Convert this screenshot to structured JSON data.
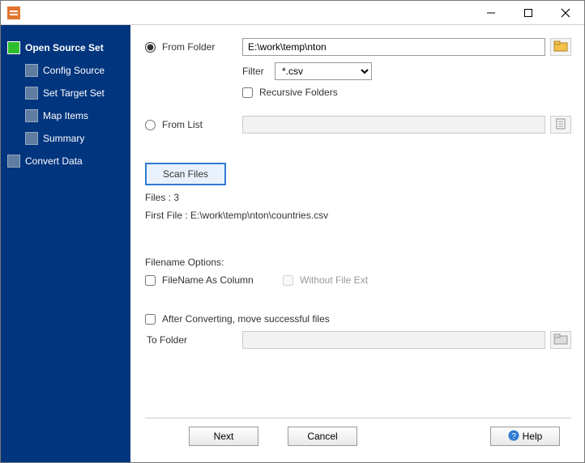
{
  "sidebar": {
    "items": [
      {
        "label": "Open Source Set"
      },
      {
        "label": "Config Source"
      },
      {
        "label": "Set Target Set"
      },
      {
        "label": "Map Items"
      },
      {
        "label": "Summary"
      },
      {
        "label": "Convert Data"
      }
    ]
  },
  "source": {
    "from_folder_label": "From Folder",
    "folder_path": "E:\\work\\temp\\nton",
    "filter_label": "Filter",
    "filter_value": "*.csv",
    "recursive_label": "Recursive Folders",
    "from_list_label": "From List",
    "list_path": ""
  },
  "scan": {
    "button": "Scan Files",
    "files_label": "Files : 3",
    "first_file": "First File : E:\\work\\temp\\nton\\countries.csv"
  },
  "filename_opts": {
    "heading": "Filename Options:",
    "as_column": "FileName As Column",
    "without_ext": "Without File Ext"
  },
  "after": {
    "move_label": "After Converting, move successful files",
    "to_folder_label": "To Folder",
    "to_folder_path": ""
  },
  "footer": {
    "next": "Next",
    "cancel": "Cancel",
    "help": "Help"
  }
}
